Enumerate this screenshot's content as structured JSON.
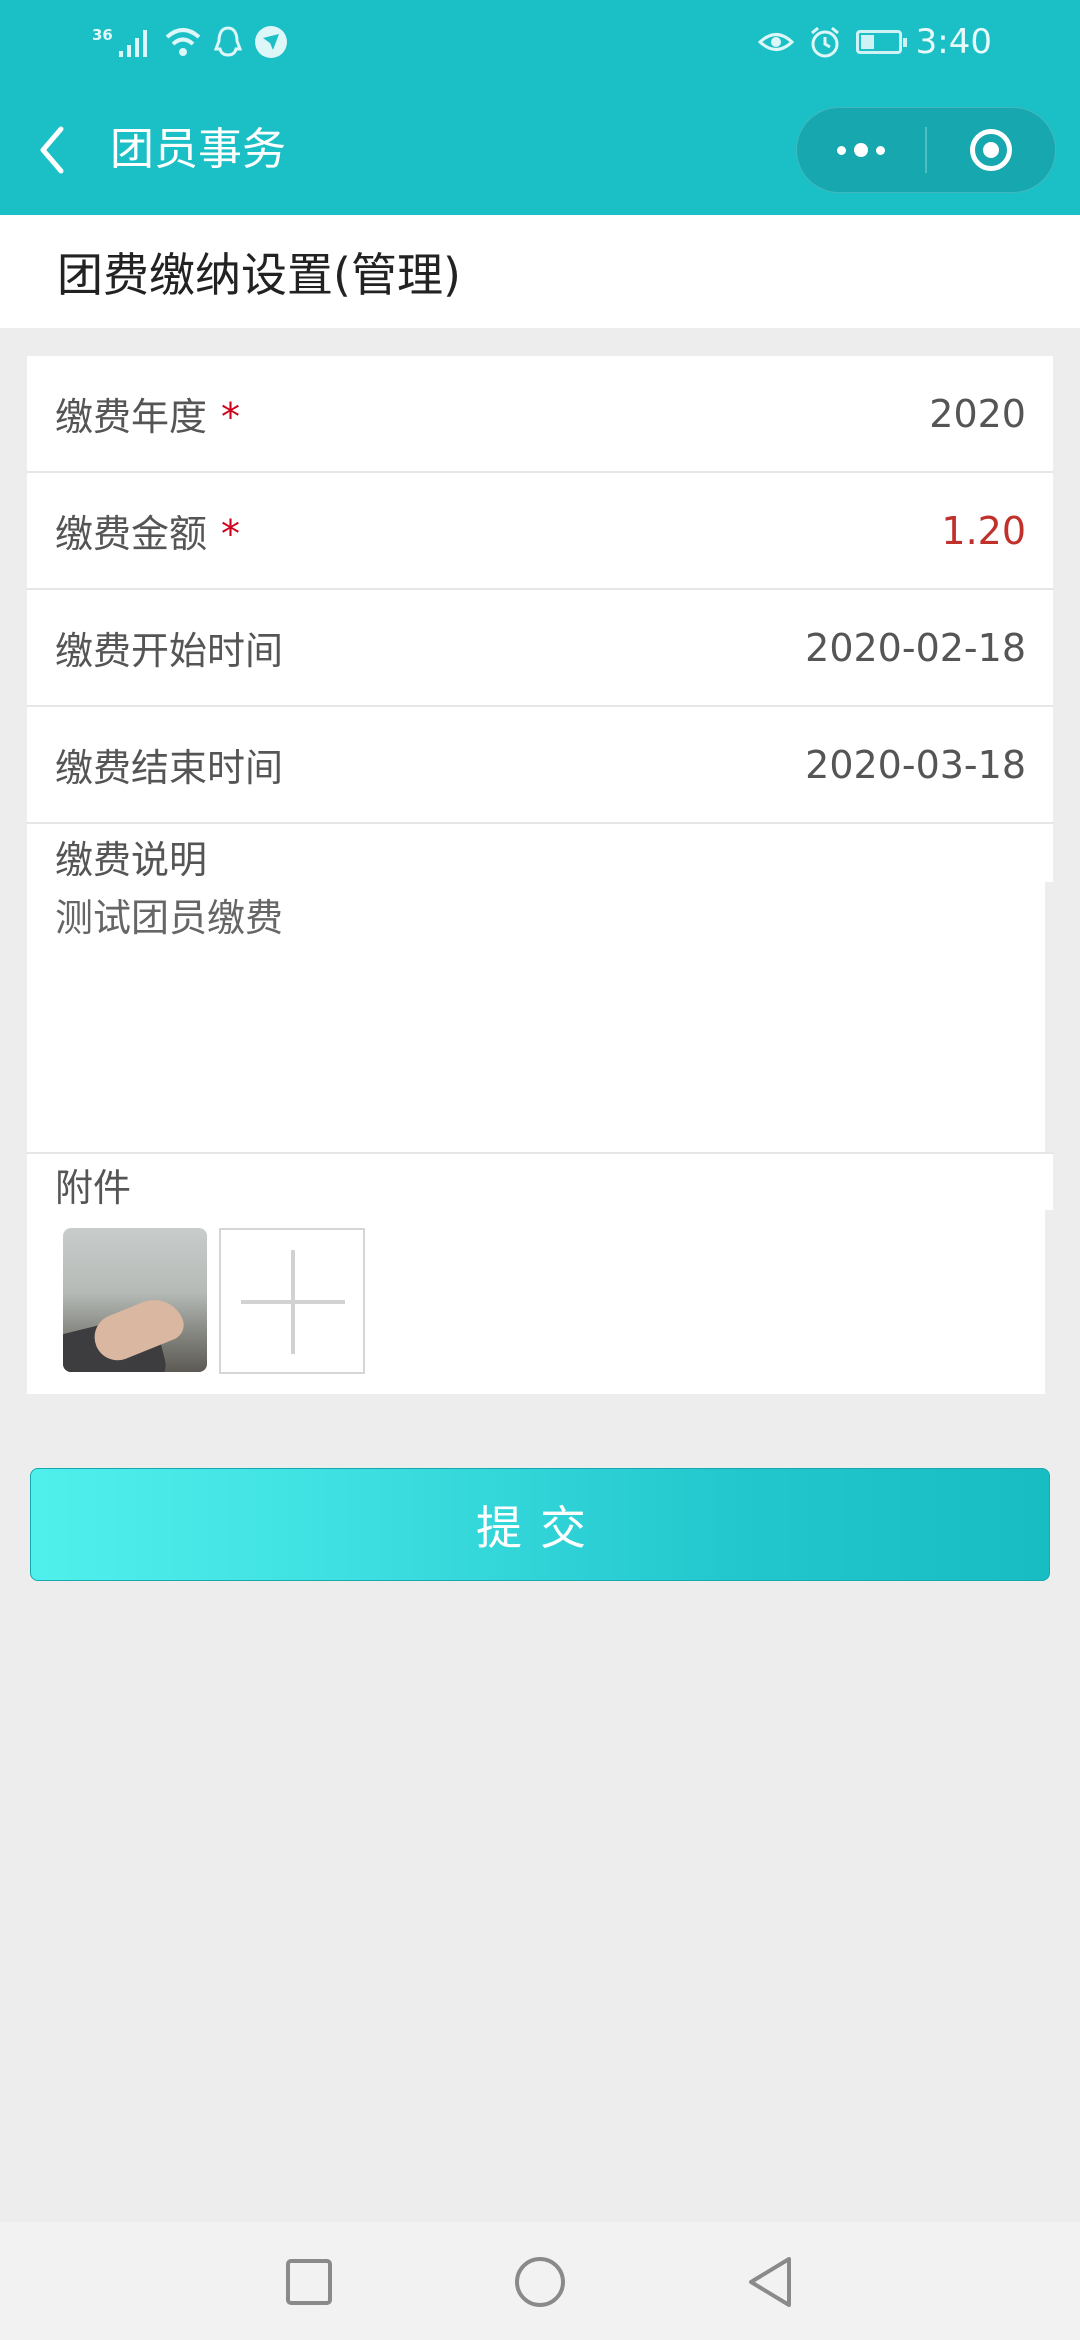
{
  "status_bar": {
    "network": "36",
    "time": "3:40",
    "battery_level": 0.35
  },
  "nav": {
    "title": "团员事务"
  },
  "page": {
    "title": "团费缴纳设置(管理)"
  },
  "form": {
    "year": {
      "label": "缴费年度",
      "required_mark": "*",
      "value": "2020"
    },
    "amount": {
      "label": "缴费金额",
      "required_mark": "*",
      "value": "1.20"
    },
    "start": {
      "label": "缴费开始时间",
      "value": "2020-02-18"
    },
    "end": {
      "label": "缴费结束时间",
      "value": "2020-03-18"
    },
    "description": {
      "label": "缴费说明",
      "value": "测试团员缴费"
    },
    "attachment": {
      "label": "附件"
    }
  },
  "submit": {
    "label": "提交"
  },
  "colors": {
    "brand": "#1bbfc6",
    "required": "#d0021b",
    "amount": "#c0312b"
  }
}
